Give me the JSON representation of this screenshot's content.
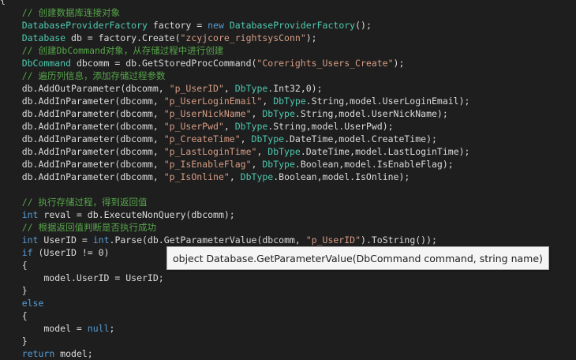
{
  "editor": {
    "lines": [
      [
        {
          "t": "{",
          "k": "plain"
        }
      ],
      [
        {
          "t": "    ",
          "k": "plain"
        },
        {
          "t": "// 创建数据库连接对象",
          "k": "comment"
        }
      ],
      [
        {
          "t": "    ",
          "k": "plain"
        },
        {
          "t": "DatabaseProviderFactory",
          "k": "type"
        },
        {
          "t": " factory = ",
          "k": "plain"
        },
        {
          "t": "new",
          "k": "keyword"
        },
        {
          "t": " ",
          "k": "plain"
        },
        {
          "t": "DatabaseProviderFactory",
          "k": "type"
        },
        {
          "t": "();",
          "k": "plain"
        }
      ],
      [
        {
          "t": "    ",
          "k": "plain"
        },
        {
          "t": "Database",
          "k": "type"
        },
        {
          "t": " db = factory.Create(",
          "k": "plain"
        },
        {
          "t": "\"zcyjcore_rightsysConn\"",
          "k": "string"
        },
        {
          "t": ");",
          "k": "plain"
        }
      ],
      [
        {
          "t": "    ",
          "k": "plain"
        },
        {
          "t": "// 创建DbCommand对象，从存储过程中进行创建",
          "k": "comment"
        }
      ],
      [
        {
          "t": "    ",
          "k": "plain"
        },
        {
          "t": "DbCommand",
          "k": "type"
        },
        {
          "t": " dbcomm = db.GetStoredProcCommand(",
          "k": "plain"
        },
        {
          "t": "\"Corerights_Users_Create\"",
          "k": "string"
        },
        {
          "t": ");",
          "k": "plain"
        }
      ],
      [
        {
          "t": "    ",
          "k": "plain"
        },
        {
          "t": "// 遍历列信息，添加存储过程参数",
          "k": "comment"
        }
      ],
      [
        {
          "t": "    db.AddOutParameter(dbcomm, ",
          "k": "plain"
        },
        {
          "t": "\"p_UserID\"",
          "k": "string"
        },
        {
          "t": ", ",
          "k": "plain"
        },
        {
          "t": "DbType",
          "k": "type"
        },
        {
          "t": ".Int32,0);",
          "k": "plain"
        }
      ],
      [
        {
          "t": "    db.AddInParameter(dbcomm, ",
          "k": "plain"
        },
        {
          "t": "\"p_UserLoginEmail\"",
          "k": "string"
        },
        {
          "t": ", ",
          "k": "plain"
        },
        {
          "t": "DbType",
          "k": "type"
        },
        {
          "t": ".String,model.UserLoginEmail);",
          "k": "plain"
        }
      ],
      [
        {
          "t": "    db.AddInParameter(dbcomm, ",
          "k": "plain"
        },
        {
          "t": "\"p_UserNickName\"",
          "k": "string"
        },
        {
          "t": ", ",
          "k": "plain"
        },
        {
          "t": "DbType",
          "k": "type"
        },
        {
          "t": ".String,model.UserNickName);",
          "k": "plain"
        }
      ],
      [
        {
          "t": "    db.AddInParameter(dbcomm, ",
          "k": "plain"
        },
        {
          "t": "\"p_UserPwd\"",
          "k": "string"
        },
        {
          "t": ", ",
          "k": "plain"
        },
        {
          "t": "DbType",
          "k": "type"
        },
        {
          "t": ".String,model.UserPwd);",
          "k": "plain"
        }
      ],
      [
        {
          "t": "    db.AddInParameter(dbcomm, ",
          "k": "plain"
        },
        {
          "t": "\"p_CreateTime\"",
          "k": "string"
        },
        {
          "t": ", ",
          "k": "plain"
        },
        {
          "t": "DbType",
          "k": "type"
        },
        {
          "t": ".DateTime,model.CreateTime);",
          "k": "plain"
        }
      ],
      [
        {
          "t": "    db.AddInParameter(dbcomm, ",
          "k": "plain"
        },
        {
          "t": "\"p_LastLoginTime\"",
          "k": "string"
        },
        {
          "t": ", ",
          "k": "plain"
        },
        {
          "t": "DbType",
          "k": "type"
        },
        {
          "t": ".DateTime,model.LastLoginTime);",
          "k": "plain"
        }
      ],
      [
        {
          "t": "    db.AddInParameter(dbcomm, ",
          "k": "plain"
        },
        {
          "t": "\"p_IsEnableFlag\"",
          "k": "string"
        },
        {
          "t": ", ",
          "k": "plain"
        },
        {
          "t": "DbType",
          "k": "type"
        },
        {
          "t": ".Boolean,model.IsEnableFlag);",
          "k": "plain"
        }
      ],
      [
        {
          "t": "    db.AddInParameter(dbcomm, ",
          "k": "plain"
        },
        {
          "t": "\"p_IsOnline\"",
          "k": "string"
        },
        {
          "t": ", ",
          "k": "plain"
        },
        {
          "t": "DbType",
          "k": "type"
        },
        {
          "t": ".Boolean,model.IsOnline);",
          "k": "plain"
        }
      ],
      [
        {
          "t": "",
          "k": "plain"
        }
      ],
      [
        {
          "t": "    ",
          "k": "plain"
        },
        {
          "t": "// 执行存储过程，得到返回值",
          "k": "comment"
        }
      ],
      [
        {
          "t": "    ",
          "k": "plain"
        },
        {
          "t": "int",
          "k": "keyword"
        },
        {
          "t": " reval = db.ExecuteNonQuery(dbcomm);",
          "k": "plain"
        }
      ],
      [
        {
          "t": "    ",
          "k": "plain"
        },
        {
          "t": "// 根据返回值判断是否执行成功",
          "k": "comment"
        }
      ],
      [
        {
          "t": "    ",
          "k": "plain"
        },
        {
          "t": "int",
          "k": "keyword"
        },
        {
          "t": " UserID = ",
          "k": "plain"
        },
        {
          "t": "int",
          "k": "keyword"
        },
        {
          "t": ".Parse(db.GetParameterValue(dbcomm, ",
          "k": "plain"
        },
        {
          "t": "\"p_UserID\"",
          "k": "string"
        },
        {
          "t": ").ToString());",
          "k": "plain"
        }
      ],
      [
        {
          "t": "    ",
          "k": "plain"
        },
        {
          "t": "if",
          "k": "keyword"
        },
        {
          "t": " (UserID != 0)",
          "k": "plain"
        }
      ],
      [
        {
          "t": "    {",
          "k": "plain"
        }
      ],
      [
        {
          "t": "        model.UserID = UserID;",
          "k": "plain"
        }
      ],
      [
        {
          "t": "    }",
          "k": "plain"
        }
      ],
      [
        {
          "t": "    ",
          "k": "plain"
        },
        {
          "t": "else",
          "k": "keyword"
        }
      ],
      [
        {
          "t": "    {",
          "k": "plain"
        }
      ],
      [
        {
          "t": "        model = ",
          "k": "plain"
        },
        {
          "t": "null",
          "k": "keyword"
        },
        {
          "t": ";",
          "k": "plain"
        }
      ],
      [
        {
          "t": "    }",
          "k": "plain"
        }
      ],
      [
        {
          "t": "    ",
          "k": "plain"
        },
        {
          "t": "return",
          "k": "keyword"
        },
        {
          "t": " model;",
          "k": "plain"
        }
      ]
    ]
  },
  "tooltip": {
    "text": "object Database.GetParameterValue(DbCommand command, string name)"
  },
  "colors": {
    "background": "#1e1e1e",
    "comment": "#57a64a",
    "keyword": "#569cd6",
    "type": "#4ec9b0",
    "string": "#d69d85",
    "plain": "#dcdcdc",
    "tooltip_background": "#f5f5f5"
  }
}
